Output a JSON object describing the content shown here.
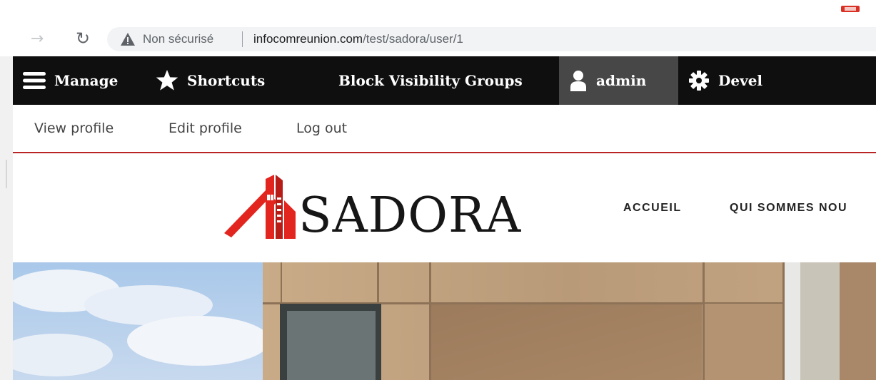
{
  "browser": {
    "security_label": "Non sécurisé",
    "url_host": "infocomreunion.com",
    "url_path": "/test/sadora/user/1",
    "icons": [
      "arrow-right-icon",
      "reload-icon",
      "warning-icon"
    ]
  },
  "toolbar": {
    "items": [
      {
        "label": "Manage",
        "icon": "hamburger-icon"
      },
      {
        "label": "Shortcuts",
        "icon": "star-icon"
      },
      {
        "label": "Block Visibility Groups",
        "icon": ""
      },
      {
        "label": "admin",
        "icon": "user-icon",
        "active": true
      },
      {
        "label": "Devel",
        "icon": "gear-icon"
      }
    ],
    "colors": {
      "background": "#0f0f0f",
      "active": "#474747"
    }
  },
  "tray": {
    "links": [
      "View profile",
      "Edit profile",
      "Log out"
    ],
    "accent": "#b92424"
  },
  "site": {
    "logo_text": "SADORA",
    "menu": [
      "ACCUEIL",
      "QUI SOMMES NOU"
    ],
    "brand_color": "#e2261f"
  }
}
